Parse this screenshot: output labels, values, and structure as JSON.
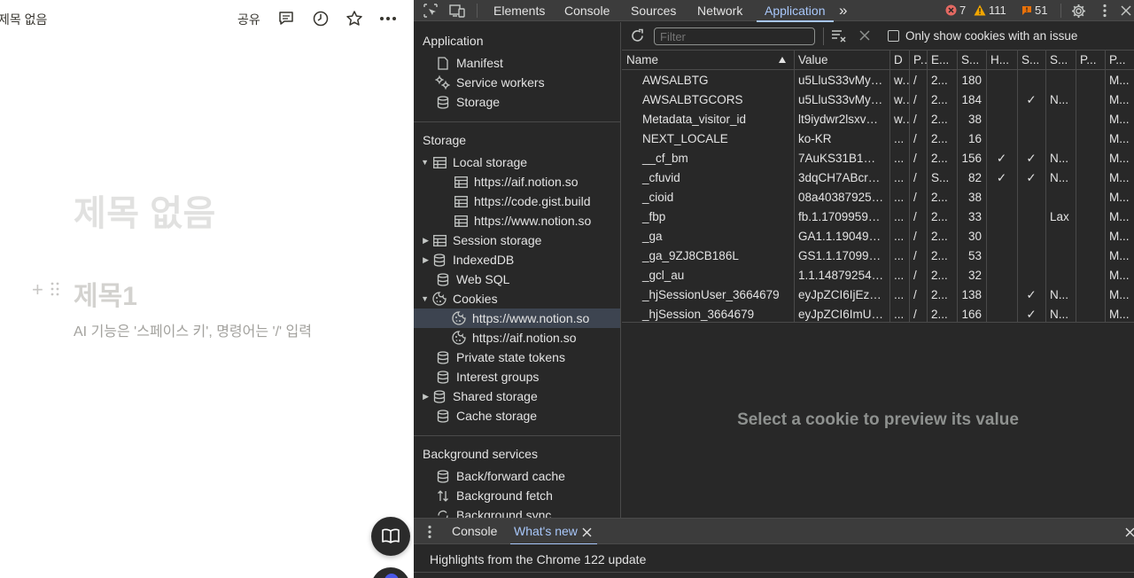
{
  "notion": {
    "doc_title": "제목 없음",
    "share_label": "공유",
    "page_title": "제목 없음",
    "heading1": "제목1",
    "placeholder": "AI 기능은 '스페이스 키', 명령어는 '/' 입력"
  },
  "devtools": {
    "tabs": [
      "Elements",
      "Console",
      "Sources",
      "Network",
      "Application"
    ],
    "active_tab": "Application",
    "more_tabs": "»",
    "errors": "7",
    "warnings": "111",
    "issues": "51",
    "colors": {
      "accent": "#a8c7fa",
      "error": "#e46962",
      "warning": "#f2a600",
      "issue": "#e8710a"
    }
  },
  "sidebar": {
    "application_heading": "Application",
    "application_items": [
      "Manifest",
      "Service workers",
      "Storage"
    ],
    "storage_heading": "Storage",
    "local_storage": "Local storage",
    "local_storage_origins": [
      "https://aif.notion.so",
      "https://code.gist.build",
      "https://www.notion.so"
    ],
    "session_storage": "Session storage",
    "indexeddb": "IndexedDB",
    "websql": "Web SQL",
    "cookies": "Cookies",
    "cookie_origins": [
      "https://www.notion.so",
      "https://aif.notion.so"
    ],
    "storage_rest": [
      "Private state tokens",
      "Interest groups",
      "Shared storage",
      "Cache storage"
    ],
    "background_heading": "Background services",
    "background_items": [
      "Back/forward cache",
      "Background fetch",
      "Background sync"
    ]
  },
  "cookies_toolbar": {
    "filter_placeholder": "Filter",
    "only_issue_label": "Only show cookies with an issue"
  },
  "cookie_table": {
    "headers": [
      "Name",
      "Value",
      "D",
      "P.",
      "E...",
      "S...",
      "H...",
      "S...",
      "S...",
      "P...",
      "P..."
    ],
    "rows": [
      [
        "AWSALBTG",
        "u5LluS33vMy…",
        "w.",
        "/",
        "2...",
        "180",
        "",
        "",
        "",
        "",
        "M..."
      ],
      [
        "AWSALBTGCORS",
        "u5LluS33vMy…",
        "w.",
        "/",
        "2...",
        "184",
        "",
        "✓",
        "N...",
        "",
        "M..."
      ],
      [
        "Metadata_visitor_id",
        "lt9iydwr2lsxv…",
        "w.",
        "/",
        "2...",
        "38",
        "",
        "",
        "",
        "",
        "M..."
      ],
      [
        "NEXT_LOCALE",
        "ko-KR",
        "...",
        "/",
        "2...",
        "16",
        "",
        "",
        "",
        "",
        "M..."
      ],
      [
        "__cf_bm",
        "7AuKS31B1m…",
        "...",
        "/",
        "2...",
        "156",
        "✓",
        "✓",
        "N...",
        "",
        "M..."
      ],
      [
        "_cfuvid",
        "3dqCH7ABcr…",
        "...",
        "/",
        "S...",
        "82",
        "✓",
        "✓",
        "N...",
        "",
        "M..."
      ],
      [
        "_cioid",
        "08a40387925…",
        "...",
        "/",
        "2...",
        "38",
        "",
        "",
        "",
        "",
        "M..."
      ],
      [
        "_fbp",
        "fb.1.1709959…",
        "...",
        "/",
        "2...",
        "33",
        "",
        "",
        "Lax",
        "",
        "M..."
      ],
      [
        "_ga",
        "GA1.1.190494…",
        "...",
        "/",
        "2...",
        "30",
        "",
        "",
        "",
        "",
        "M..."
      ],
      [
        "_ga_9ZJ8CB186L",
        "GS1.1.170996…",
        "...",
        "/",
        "2...",
        "53",
        "",
        "",
        "",
        "",
        "M..."
      ],
      [
        "_gcl_au",
        "1.1.14879254…",
        "...",
        "/",
        "2...",
        "32",
        "",
        "",
        "",
        "",
        "M..."
      ],
      [
        "_hjSessionUser_3664679",
        "eyJpZCI6IjEz…",
        "...",
        "/",
        "2...",
        "138",
        "",
        "✓",
        "N...",
        "",
        "M..."
      ],
      [
        "_hjSession_3664679",
        "eyJpZCI6ImU…",
        "...",
        "/",
        "2...",
        "166",
        "",
        "✓",
        "N...",
        "",
        "M..."
      ]
    ]
  },
  "preview_text": "Select a cookie to preview its value",
  "drawer": {
    "tabs": [
      "Console",
      "What's new"
    ],
    "active_tab": "What's new",
    "body_text": "Highlights from the Chrome 122 update"
  }
}
